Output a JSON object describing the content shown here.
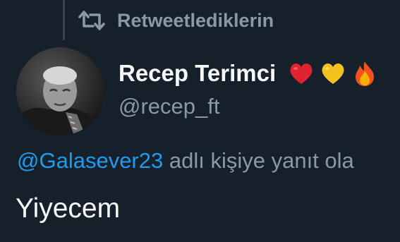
{
  "retweet": {
    "icon": "retweet-icon",
    "label": "Retweetlediklerin"
  },
  "author": {
    "avatar_icon": "avatar",
    "display_name": "Recep Terimci",
    "emojis": [
      "red-heart-emoji",
      "yellow-heart-emoji",
      "fire-emoji"
    ],
    "handle": "@recep_ft"
  },
  "reply": {
    "mention": "@Galasever23",
    "suffix": " adlı kişiye yanıt ola"
  },
  "tweet": {
    "text": "Yiyecem"
  },
  "colors": {
    "background": "#15202b",
    "secondary_text": "#8b98a5",
    "primary_text": "#f7f9f9",
    "mention": "#1d9bf0"
  }
}
